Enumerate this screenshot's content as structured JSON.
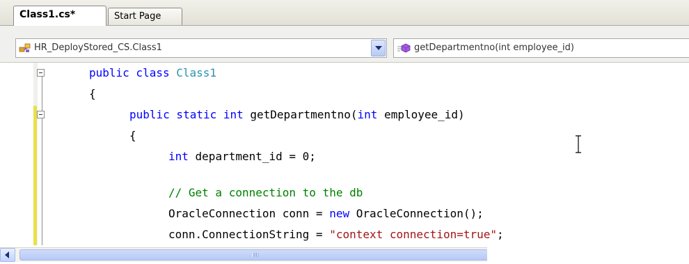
{
  "tabs": [
    {
      "label": "Class1.cs*",
      "active": true
    },
    {
      "label": "Start Page",
      "active": false
    }
  ],
  "navbar": {
    "type_combo": {
      "value": "HR_DeployStored_CS.Class1",
      "icon": "class-icon"
    },
    "member_combo": {
      "value": "getDepartmentno(int employee_id)",
      "icon": "method-icon"
    }
  },
  "code": {
    "lines": [
      [
        {
          "t": "public class ",
          "c": "kw"
        },
        {
          "t": "Class1",
          "c": "ty"
        }
      ],
      [
        {
          "t": "{",
          "c": ""
        }
      ],
      [
        {
          "t": "public static int ",
          "c": "kw"
        },
        {
          "t": "getDepartmentno(",
          "c": ""
        },
        {
          "t": "int",
          "c": "kw"
        },
        {
          "t": " employee_id)",
          "c": ""
        }
      ],
      [
        {
          "t": "{",
          "c": ""
        }
      ],
      [
        {
          "t": "int",
          "c": "kw"
        },
        {
          "t": " department_id = 0;",
          "c": ""
        }
      ],
      [],
      [
        {
          "t": "// Get a connection to the db",
          "c": "cm"
        }
      ],
      [
        {
          "t": "OracleConnection conn = ",
          "c": ""
        },
        {
          "t": "new",
          "c": "kw"
        },
        {
          "t": " OracleConnection();",
          "c": ""
        }
      ],
      [
        {
          "t": "conn.ConnectionString = ",
          "c": ""
        },
        {
          "t": "\"context connection=true\"",
          "c": "st"
        },
        {
          "t": ";",
          "c": ""
        }
      ]
    ]
  },
  "colors": {
    "keyword": "#0000ff",
    "type": "#2b91af",
    "comment": "#008000",
    "string": "#a31515",
    "change_marker": "#e7e14a"
  }
}
